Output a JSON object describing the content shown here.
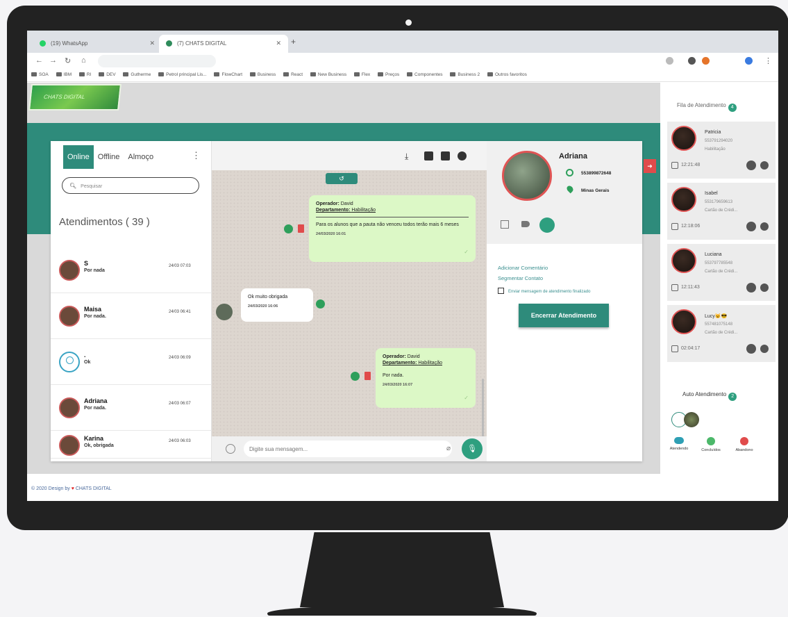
{
  "browser": {
    "tabs": [
      {
        "label": "(19) WhatsApp",
        "active": false
      },
      {
        "label": "(7) CHATS DIGITAL",
        "active": true
      }
    ],
    "bookmarks": [
      "SOA",
      "IBM",
      "RI",
      "DEV",
      "Gutherme",
      "Petrol principal Lis...",
      "FlowChart",
      "Business",
      "React",
      "New Business",
      "Flex",
      "Preços",
      "Componentes",
      "Business 2",
      "Outros favoritos"
    ]
  },
  "app": {
    "logo_text": "CHATS DIGITAL",
    "footer_prefix": "© 2020 Design by",
    "footer_brand": "CHATS DIGITAL"
  },
  "left_panel": {
    "tabs": [
      "Online",
      "Offline",
      "Almoço"
    ],
    "search_placeholder": "Pesquisar",
    "count_title": "Atendimentos ( 39 )",
    "conversations": [
      {
        "name": "S",
        "last_message": "Por nada",
        "time": "24/03 07:03"
      },
      {
        "name": "Maisa",
        "last_message": "Por nada.",
        "time": "24/03 06:41"
      },
      {
        "name": ".",
        "last_message": "Ok",
        "time": "24/03 06:09"
      },
      {
        "name": "Adriana",
        "last_message": "Por nada.",
        "time": "24/03 06:07"
      },
      {
        "name": "Karina",
        "last_message": "Ok, obrigada",
        "time": "24/03 06:03"
      }
    ]
  },
  "chat": {
    "messages": [
      {
        "direction": "out",
        "operator_label": "Operador:",
        "operator": "David",
        "department_label": "Departamento:",
        "department": "Habilitação",
        "text": "Para os alunos que a pauta não venceu todos terão mais 6 meses",
        "time": "24/03/2020 16:01"
      },
      {
        "direction": "in",
        "text": "Ok muito obrigada",
        "time": "24/03/2020 16:06"
      },
      {
        "direction": "out",
        "operator_label": "Operador:",
        "operator": "David",
        "department_label": "Departamento:",
        "department": "Habilitação",
        "text": "Por nada.",
        "time": "24/03/2020 16:07"
      }
    ],
    "input_placeholder": "Digite sua mensagem..."
  },
  "contact": {
    "name": "Adriana",
    "phone": "553899872648",
    "location": "Minas Gerais",
    "add_comment": "Adicionar Comentário",
    "segment_contact": "Segmentar Contato",
    "send_end_message": "Enviar mensagem de atendimento finalizado",
    "end_button": "Encerrar Atendimento"
  },
  "queue": {
    "title": "Fila de Atendimento",
    "count": "4",
    "items": [
      {
        "name": "Patricia",
        "phone": "553791294020",
        "department": "Habilitação",
        "time": "12:21:48"
      },
      {
        "name": "Isabel",
        "phone": "553179659613",
        "department": "Cartão de Crédi...",
        "time": "12:18:06"
      },
      {
        "name": "Luciana",
        "phone": "553797785548",
        "department": "Cartão de Crédi...",
        "time": "12:11:43"
      },
      {
        "name": "Lucy😺😎",
        "phone": "557481075148",
        "department": "Cartão de Crédi...",
        "time": "02:04:17"
      }
    ],
    "auto_title": "Auto Atendimento",
    "auto_count": "2",
    "legend": [
      {
        "label": "Atendendo",
        "color": "#2e9fb4"
      },
      {
        "label": "Concluídos",
        "color": "#4cb86a"
      },
      {
        "label": "Abandono",
        "color": "#e04b4b"
      }
    ]
  },
  "colors": {
    "primary": "#2e8b7b",
    "bubble_out": "#dcf8c6",
    "danger": "#e04b4b"
  }
}
